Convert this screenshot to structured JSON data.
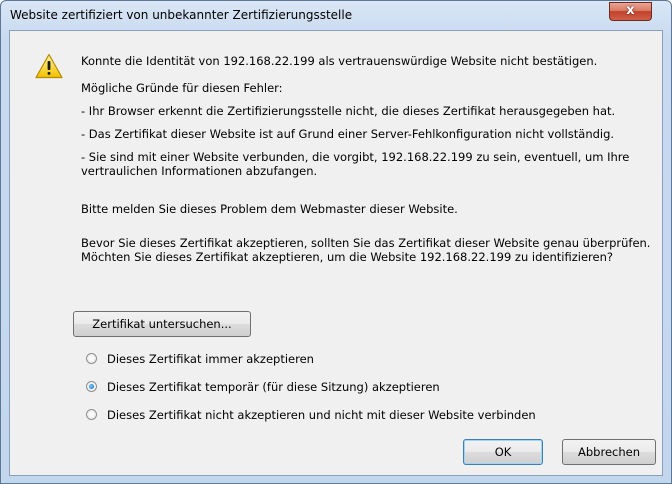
{
  "window": {
    "title": "Website zertifiziert von unbekannter Zertifizierungsstelle",
    "close_label": "x"
  },
  "message": {
    "headline": "Konnte die Identität von 192.168.22.199 als vertrauenswürdige Website nicht bestätigen.",
    "reasons_heading": "Mögliche Gründe für diesen Fehler:",
    "reasons": [
      "- Ihr Browser erkennt die Zertifizierungsstelle nicht, die dieses Zertifikat herausgegeben hat.",
      "- Das Zertifikat dieser Website ist auf Grund einer Server-Fehlkonfiguration nicht vollständig.",
      "- Sie sind mit einer Website verbunden, die vorgibt, 192.168.22.199 zu sein, eventuell, um Ihre vertraulichen Informationen abzufangen."
    ],
    "report": "Bitte melden Sie dieses Problem dem Webmaster dieser Website.",
    "before_accept": "Bevor Sie dieses Zertifikat akzeptieren, sollten Sie das Zertifikat dieser Website genau überprüfen. Möchten Sie dieses Zertifikat akzeptieren, um die Website 192.168.22.199 zu identifizieren?"
  },
  "buttons": {
    "examine": "Zertifikat untersuchen...",
    "ok": "OK",
    "cancel": "Abbrechen"
  },
  "options": [
    {
      "label": "Dieses Zertifikat immer akzeptieren",
      "checked": false
    },
    {
      "label": "Dieses Zertifikat temporär (für diese Sitzung) akzeptieren",
      "checked": true
    },
    {
      "label": "Dieses Zertifikat nicht akzeptieren und nicht mit dieser Website verbinden",
      "checked": false
    }
  ],
  "icons": {
    "warning": "warning-icon"
  }
}
